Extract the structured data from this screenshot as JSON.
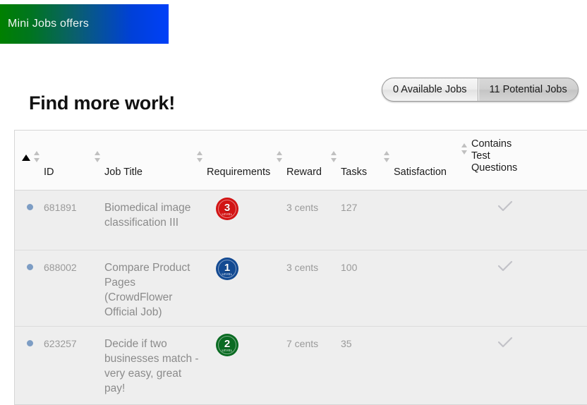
{
  "banner": {
    "title": "Mini Jobs offers",
    "gradient_from": "#008000",
    "gradient_to": "#0040f8"
  },
  "page": {
    "title": "Find more work!"
  },
  "toggle": {
    "available_label": "0 Available Jobs",
    "potential_label": "11 Potential Jobs",
    "selected": "11 Potential Jobs"
  },
  "table": {
    "columns": [
      {
        "key": "mark",
        "label": ""
      },
      {
        "key": "id",
        "label": "ID"
      },
      {
        "key": "title",
        "label": "Job Title"
      },
      {
        "key": "req",
        "label": "Requirements"
      },
      {
        "key": "reward",
        "label": "Reward"
      },
      {
        "key": "tasks",
        "label": "Tasks"
      },
      {
        "key": "sat",
        "label": "Satisfaction"
      },
      {
        "key": "ctq",
        "label": "Contains Test Questions"
      }
    ],
    "ctq_label_lines": [
      "Contains",
      "Test",
      "Questions"
    ],
    "sorted_column": "mark",
    "sort_direction": "asc",
    "rows": [
      {
        "id": "681891",
        "title": "Biomedical image classification III",
        "level": "3",
        "level_word": "LEVEL",
        "level_color": "#d21414",
        "reward": "3 cents",
        "tasks": "127",
        "satisfaction": "",
        "contains_test_questions": true
      },
      {
        "id": "688002",
        "title": "Compare Product Pages (CrowdFlower Official Job)",
        "level": "1",
        "level_word": "LEVEL",
        "level_color": "#134a92",
        "reward": "3 cents",
        "tasks": "100",
        "satisfaction": "",
        "contains_test_questions": true
      },
      {
        "id": "623257",
        "title": "Decide if two businesses match - very easy, great pay!",
        "level": "2",
        "level_word": "LEVEL",
        "level_color": "#0a6b22",
        "reward": "7 cents",
        "tasks": "35",
        "satisfaction": "",
        "contains_test_questions": true
      }
    ]
  },
  "icons": {
    "sort": "sort-updown-icon",
    "sort_active": "sort-ascending-icon",
    "check": "check-icon",
    "bullet": "bullet-dot-icon"
  }
}
